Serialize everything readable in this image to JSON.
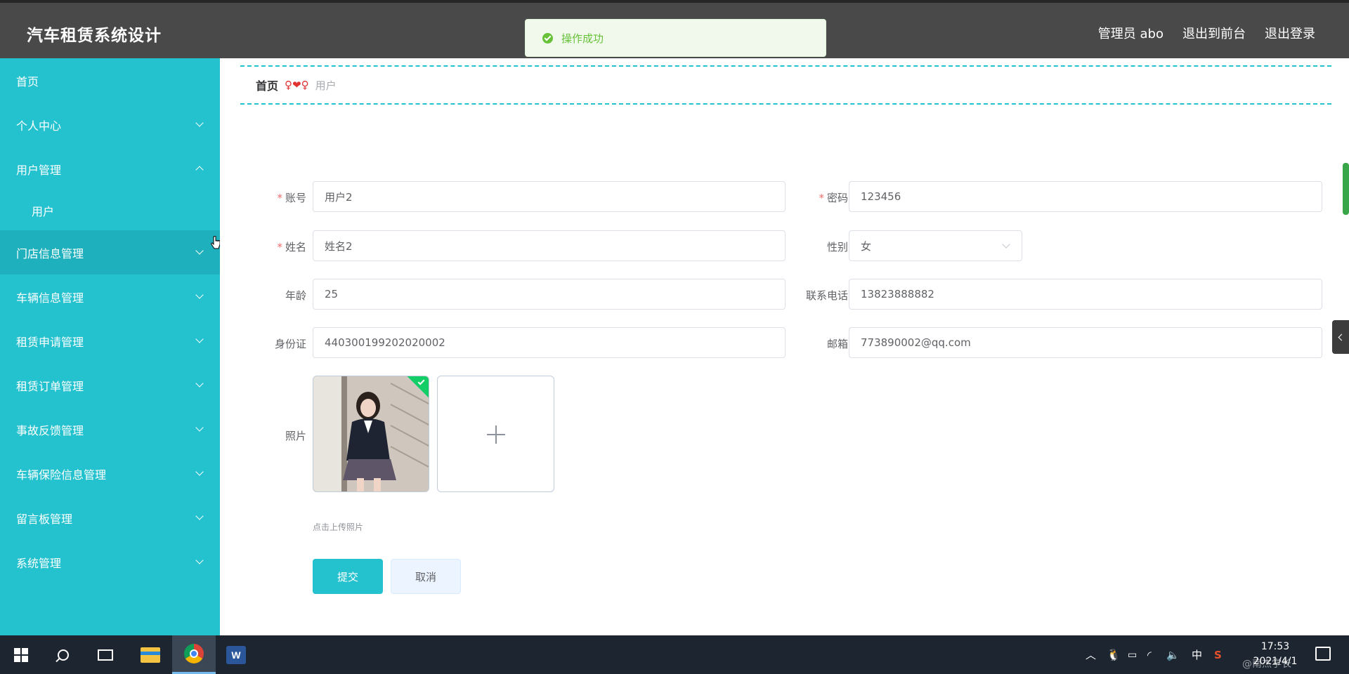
{
  "header": {
    "brand": "汽车租赁系统设计",
    "user": "管理员 abo",
    "to_front": "退出到前台",
    "logout": "退出登录"
  },
  "toast": {
    "message": "操作成功",
    "icon": "success-check-icon",
    "color": "#67c23a"
  },
  "sidebar": {
    "items": [
      {
        "label": "首页"
      },
      {
        "label": "个人中心"
      },
      {
        "label": "用户管理"
      },
      {
        "label": "用户"
      },
      {
        "label": "门店信息管理"
      },
      {
        "label": "车辆信息管理"
      },
      {
        "label": "租赁申请管理"
      },
      {
        "label": "租赁订单管理"
      },
      {
        "label": "事故反馈管理"
      },
      {
        "label": "车辆保险信息管理"
      },
      {
        "label": "留言板管理"
      },
      {
        "label": "系统管理"
      }
    ]
  },
  "breadcrumb": {
    "home": "首页",
    "separator": "♀❤♀",
    "current": "用户"
  },
  "form": {
    "account_label": "账号",
    "account_value": "用户2",
    "password_label": "密码",
    "password_value": "123456",
    "name_label": "姓名",
    "name_value": "姓名2",
    "gender_label": "性别",
    "gender_value": "女",
    "age_label": "年龄",
    "age_value": "25",
    "phone_label": "联系电话",
    "phone_value": "13823888882",
    "idcard_label": "身份证",
    "idcard_value": "440300199202020002",
    "email_label": "邮箱",
    "email_value": "773890002@qq.com",
    "photo_label": "照片",
    "upload_tip": "点击上传照片",
    "submit": "提交",
    "cancel": "取消",
    "required_mark": "*"
  },
  "taskbar": {
    "time": "17:53",
    "date": "2021/4/1",
    "ime": "中",
    "watermark": "@南杰学长"
  },
  "colors": {
    "accent": "#24c1cf",
    "header": "#494949",
    "success": "#67c23a"
  }
}
